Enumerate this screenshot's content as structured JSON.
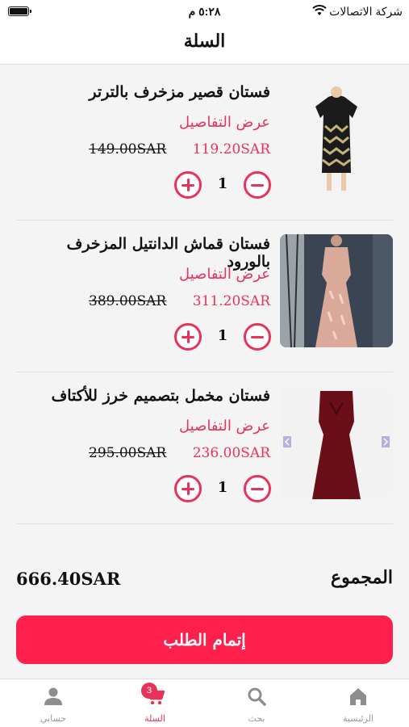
{
  "status_bar": {
    "time": "٥:٢٨ م",
    "carrier": "شركة الاتصالات"
  },
  "header": {
    "title": "السلة"
  },
  "cart": {
    "details_label": "عرض التفاصيل",
    "items": [
      {
        "name": "فستان قصير مزخرف بالترتر",
        "price": "119.20SAR",
        "original_price": "149.00SAR",
        "quantity": "1"
      },
      {
        "name": "فستان قماش الدانتيل المزخرف بالورود",
        "price": "311.20SAR",
        "original_price": "389.00SAR",
        "quantity": "1"
      },
      {
        "name": "فستان مخمل بتصميم خرز للأكتاف",
        "price": "236.00SAR",
        "original_price": "295.00SAR",
        "quantity": "1"
      }
    ]
  },
  "summary": {
    "total_label": "المجموع",
    "total_value": "666.40SAR"
  },
  "checkout_label": "إتمام الطلب",
  "tab_bar": {
    "tabs": [
      {
        "label": "الرئيسية",
        "icon": "home-icon"
      },
      {
        "label": "بحث",
        "icon": "search-icon"
      },
      {
        "label": "السلة",
        "icon": "cart-icon",
        "badge": "3",
        "active": true
      },
      {
        "label": "حسابي",
        "icon": "account-icon"
      }
    ]
  },
  "colors": {
    "accent": "#e8325a",
    "checkout_button": "#ff1f4d",
    "inactive_tab": "#999999"
  }
}
